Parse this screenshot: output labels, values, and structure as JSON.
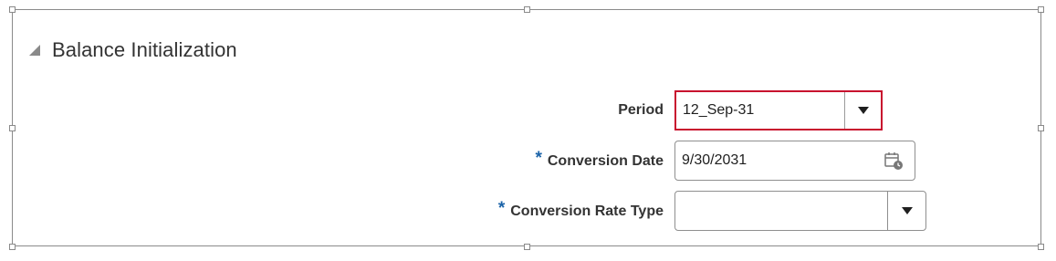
{
  "section": {
    "title": "Balance Initialization",
    "collapse_icon": "collapse-triangle-icon"
  },
  "form": {
    "period": {
      "label": "Period",
      "value": "12_Sep-31",
      "required": false,
      "highlight_color": "#c8102e"
    },
    "conversion_date": {
      "label": "Conversion Date",
      "value": "9/30/2031",
      "required": true,
      "icon": "calendar-icon"
    },
    "conversion_rate_type": {
      "label": "Conversion Rate Type",
      "value": "",
      "required": true
    }
  },
  "required_marker": "*",
  "colors": {
    "required": "#1b63a8",
    "highlight": "#c8102e",
    "text": "#333333"
  }
}
